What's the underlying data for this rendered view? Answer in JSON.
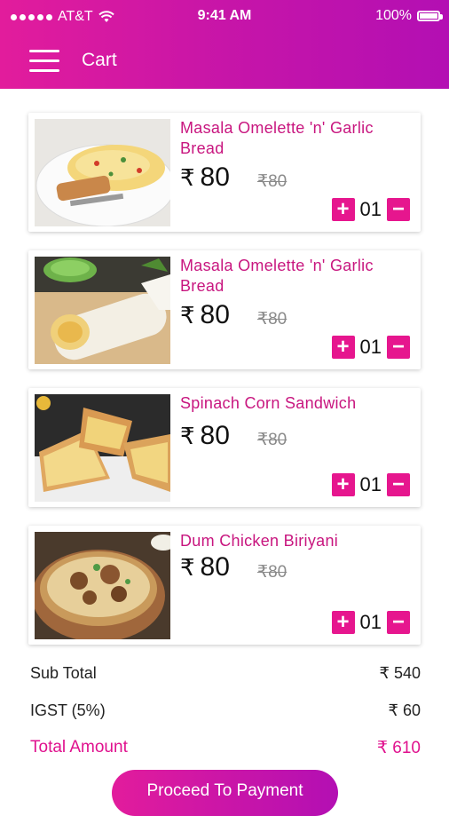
{
  "status_bar": {
    "carrier": "AT&T",
    "time": "9:41 AM",
    "battery": "100%"
  },
  "header": {
    "title": "Cart",
    "menu_icon": "hamburger-menu-icon"
  },
  "cart": {
    "currency": "₹",
    "items": [
      {
        "name": "Masala Omelette 'n' Garlic Bread",
        "price": "80",
        "old_price": "80",
        "quantity": "01",
        "plus": "+",
        "minus": "−"
      },
      {
        "name": "Masala Omelette 'n' Garlic Bread",
        "price": "80",
        "old_price": "80",
        "quantity": "01",
        "plus": "+",
        "minus": "−"
      },
      {
        "name": "Spinach Corn Sandwich",
        "price": "80",
        "old_price": "80",
        "quantity": "01",
        "plus": "+",
        "minus": "−"
      },
      {
        "name": "Dum Chicken Biriyani",
        "price": "80",
        "old_price": "80",
        "quantity": "01",
        "plus": "+",
        "minus": "−"
      }
    ]
  },
  "summary": {
    "subtotal_label": "Sub Total",
    "subtotal_value": "₹ 540",
    "tax_label": "IGST (5%)",
    "tax_value": "₹ 60",
    "total_label": "Total Amount",
    "total_value": "₹ 610"
  },
  "actions": {
    "proceed_label": "Proceed To Payment"
  },
  "colors": {
    "accent": "#e6168e",
    "header_start": "#e21c9c",
    "header_end": "#b30fb3"
  }
}
